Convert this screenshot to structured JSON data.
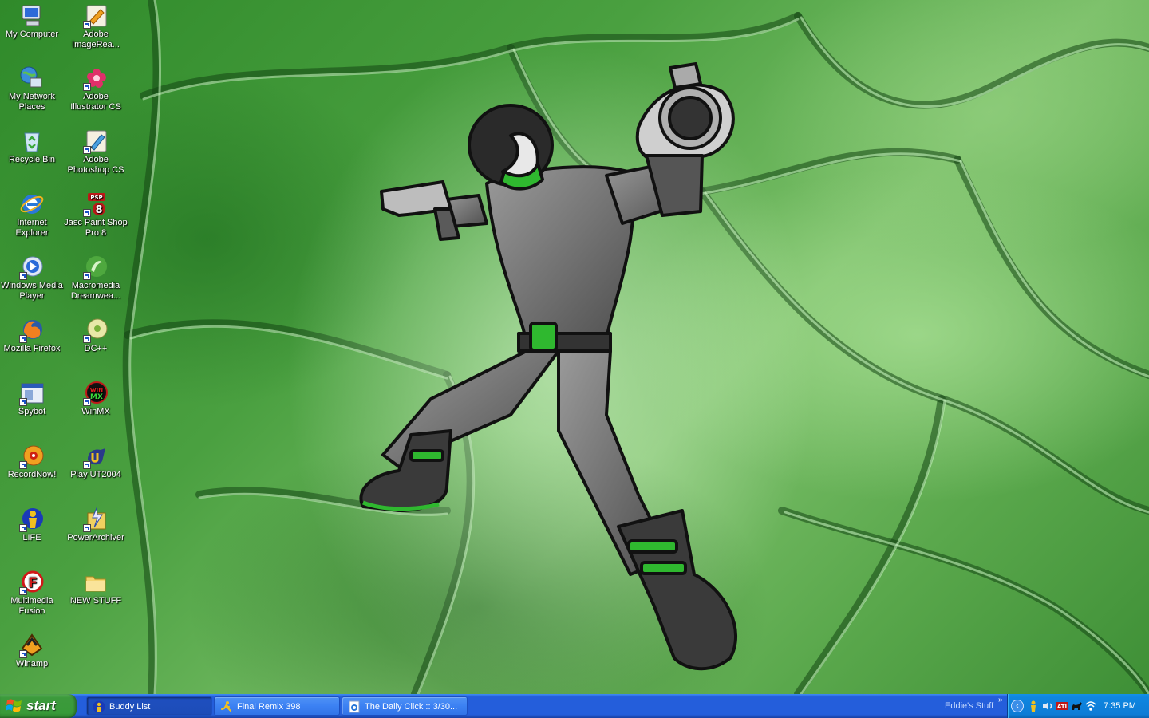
{
  "desktop": {
    "icons": [
      {
        "label": "My Computer",
        "icon": "my-computer-icon"
      },
      {
        "label": "Adobe ImageRea...",
        "icon": "adobe-imageready-icon"
      },
      {
        "label": "My Network Places",
        "icon": "my-network-places-icon"
      },
      {
        "label": "Adobe Illustrator CS",
        "icon": "adobe-illustrator-icon"
      },
      {
        "label": "Recycle Bin",
        "icon": "recycle-bin-icon"
      },
      {
        "label": "Adobe Photoshop CS",
        "icon": "adobe-photoshop-icon"
      },
      {
        "label": "Internet Explorer",
        "icon": "internet-explorer-icon"
      },
      {
        "label": "Jasc Paint Shop Pro 8",
        "icon": "paint-shop-pro-icon",
        "badge": "PSP"
      },
      {
        "label": "Windows Media Player",
        "icon": "windows-media-player-icon"
      },
      {
        "label": "Macromedia Dreamwea...",
        "icon": "dreamweaver-icon"
      },
      {
        "label": "Mozilla Firefox",
        "icon": "firefox-icon"
      },
      {
        "label": "DC++",
        "icon": "dcplusplus-icon"
      },
      {
        "label": "Spybot",
        "icon": "spybot-icon"
      },
      {
        "label": "WinMX",
        "icon": "winmx-icon"
      },
      {
        "label": "RecordNow!",
        "icon": "recordnow-icon"
      },
      {
        "label": "Play UT2004",
        "icon": "ut2004-icon"
      },
      {
        "label": "LIFE",
        "icon": "aim-life-icon"
      },
      {
        "label": "PowerArchiver",
        "icon": "powerarchiver-icon"
      },
      {
        "label": "Multimedia Fusion",
        "icon": "multimedia-fusion-icon"
      },
      {
        "label": "NEW STUFF",
        "icon": "folder-icon"
      },
      {
        "label": "Winamp",
        "icon": "winamp-icon"
      }
    ]
  },
  "taskbar": {
    "start_label": "start",
    "buttons": [
      {
        "label": "Buddy List",
        "icon": "aim-buddy-icon",
        "active": true
      },
      {
        "label": "Final Remix 398",
        "icon": "aim-running-man-icon",
        "active": false
      },
      {
        "label": "The Daily Click :: 3/30...",
        "icon": "ie-page-icon",
        "active": false
      }
    ],
    "toolbar_label": "Eddie's Stuff",
    "chevron": "»",
    "tray_expand": "‹",
    "tray_icons": [
      "aim-tray-icon",
      "volume-tray-icon",
      "ati-tray-icon",
      "dog-tray-icon",
      "wireless-tray-icon"
    ],
    "clock": "7:35 PM"
  },
  "colors": {
    "taskbar": "#245edb",
    "start": "#3c9a3c",
    "tray": "#0f86e0",
    "wallpaper_green": "#4aa040"
  }
}
